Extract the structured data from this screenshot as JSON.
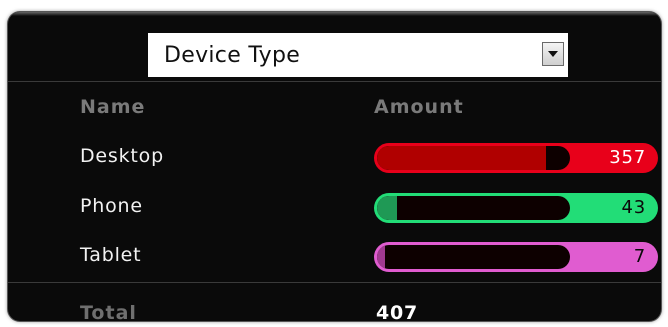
{
  "selector": {
    "value": "Device Type"
  },
  "table": {
    "headers": {
      "name": "Name",
      "amount": "Amount"
    },
    "rows": [
      {
        "name": "Desktop",
        "amount": "357",
        "share": 0.877,
        "color": "#e8001a",
        "fill": "#b00000",
        "text_color": "#ffffff"
      },
      {
        "name": "Phone",
        "amount": "43",
        "share": 0.106,
        "color": "#22dd77",
        "fill": "#1f9955",
        "text_color": "#0a0a0a"
      },
      {
        "name": "Tablet",
        "amount": "7",
        "share": 0.017,
        "color": "#e05cd0",
        "fill": "#a03a90",
        "text_color": "#0a0a0a"
      }
    ],
    "total": {
      "label": "Total",
      "value": "407"
    }
  }
}
